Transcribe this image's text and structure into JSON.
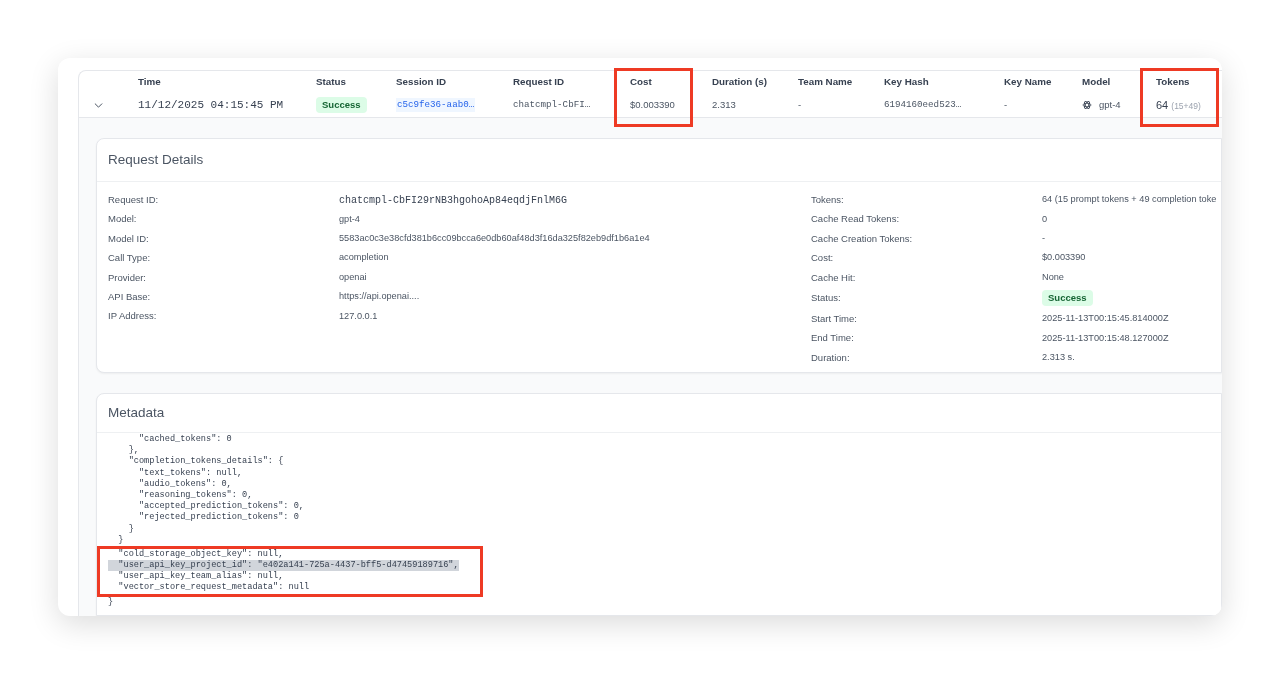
{
  "table": {
    "columns": [
      {
        "label": "Time",
        "kind": "time",
        "framed": false
      },
      {
        "label": "Status",
        "kind": "badge",
        "framed": false
      },
      {
        "label": "Session ID",
        "kind": "link",
        "framed": false
      },
      {
        "label": "Request ID",
        "kind": "mono",
        "framed": false
      },
      {
        "label": "Cost",
        "kind": "text",
        "framed": true
      },
      {
        "label": "Duration (s)",
        "kind": "text",
        "framed": false
      },
      {
        "label": "Team Name",
        "kind": "text",
        "framed": false
      },
      {
        "label": "Key Hash",
        "kind": "mono",
        "framed": false
      },
      {
        "label": "Key Name",
        "kind": "text",
        "framed": false
      },
      {
        "label": "Model",
        "kind": "model",
        "framed": false
      },
      {
        "label": "Tokens",
        "kind": "tokens",
        "framed": true
      }
    ],
    "rows": [
      {
        "expanded": true,
        "cells": [
          {
            "text": "11/12/2025 04:15:45 PM"
          },
          {
            "text": "Success"
          },
          {
            "text": "c5c9fe36-aab0…"
          },
          {
            "text": "chatcmpl-CbFI…"
          },
          {
            "text": "$0.003390"
          },
          {
            "text": "2.313"
          },
          {
            "text": "-"
          },
          {
            "text": "6194160eed523…"
          },
          {
            "text": "-"
          },
          {
            "text": "gpt-4"
          },
          {
            "text": "64",
            "detail": "(15+49)"
          }
        ]
      }
    ]
  },
  "request_details": {
    "title": "Request Details",
    "left": [
      {
        "label": "Request ID:",
        "value": "chatcmpl-CbFI29rNB3hgohoAp84eqdjFnlM6G",
        "kind": "mono"
      },
      {
        "label": "Model:",
        "value": "gpt-4",
        "kind": "text"
      },
      {
        "label": "Model ID:",
        "value": "5583ac0c3e38cfd381b6cc09bcca6e0db60af48d3f16da325f82eb9df1b6a1e4",
        "kind": "text"
      },
      {
        "label": "Call Type:",
        "value": "acompletion",
        "kind": "text"
      },
      {
        "label": "Provider:",
        "value": "openai",
        "kind": "text"
      },
      {
        "label": "API Base:",
        "value": "https://api.openai....",
        "kind": "text"
      },
      {
        "label": "IP Address:",
        "value": "127.0.0.1",
        "kind": "text"
      }
    ],
    "right": [
      {
        "label": "Tokens:",
        "value": "64 (15 prompt tokens + 49 completion toke",
        "kind": "text"
      },
      {
        "label": "Cache Read Tokens:",
        "value": "0",
        "kind": "text"
      },
      {
        "label": "Cache Creation Tokens:",
        "value": "-",
        "kind": "text"
      },
      {
        "label": "Cost:",
        "value": "$0.003390",
        "kind": "text"
      },
      {
        "label": "Cache Hit:",
        "value": "None",
        "kind": "text"
      },
      {
        "label": "Status:",
        "value": "Success",
        "kind": "badge"
      },
      {
        "label": "Start Time:",
        "value": "2025-11-13T00:15:45.814000Z",
        "kind": "text"
      },
      {
        "label": "End Time:",
        "value": "2025-11-13T00:15:48.127000Z",
        "kind": "text"
      },
      {
        "label": "Duration:",
        "value": "2.313 s.",
        "kind": "text"
      }
    ]
  },
  "metadata": {
    "title": "Metadata",
    "lines": [
      {
        "text": "      \"cached_tokens\": 0",
        "selected": false,
        "framed": false
      },
      {
        "text": "    },",
        "selected": false,
        "framed": false
      },
      {
        "text": "    \"completion_tokens_details\": {",
        "selected": false,
        "framed": false
      },
      {
        "text": "      \"text_tokens\": null,",
        "selected": false,
        "framed": false
      },
      {
        "text": "      \"audio_tokens\": 0,",
        "selected": false,
        "framed": false
      },
      {
        "text": "      \"reasoning_tokens\": 0,",
        "selected": false,
        "framed": false
      },
      {
        "text": "      \"accepted_prediction_tokens\": 0,",
        "selected": false,
        "framed": false
      },
      {
        "text": "      \"rejected_prediction_tokens\": 0",
        "selected": false,
        "framed": false
      },
      {
        "text": "    }",
        "selected": false,
        "framed": false
      },
      {
        "text": "  }",
        "selected": false,
        "framed": false
      },
      {
        "text": "  \"cold_storage_object_key\": null,",
        "selected": false,
        "framed": true
      },
      {
        "text": "  \"user_api_key_project_id\": \"e402a141-725a-4437-bff5-d47459189716\",",
        "selected": true,
        "framed": true
      },
      {
        "text": "  \"user_api_key_team_alias\": null,",
        "selected": false,
        "framed": true
      },
      {
        "text": "  \"vector_store_request_metadata\": null",
        "selected": false,
        "framed": true
      },
      {
        "text": "}",
        "selected": false,
        "framed": false
      }
    ]
  }
}
